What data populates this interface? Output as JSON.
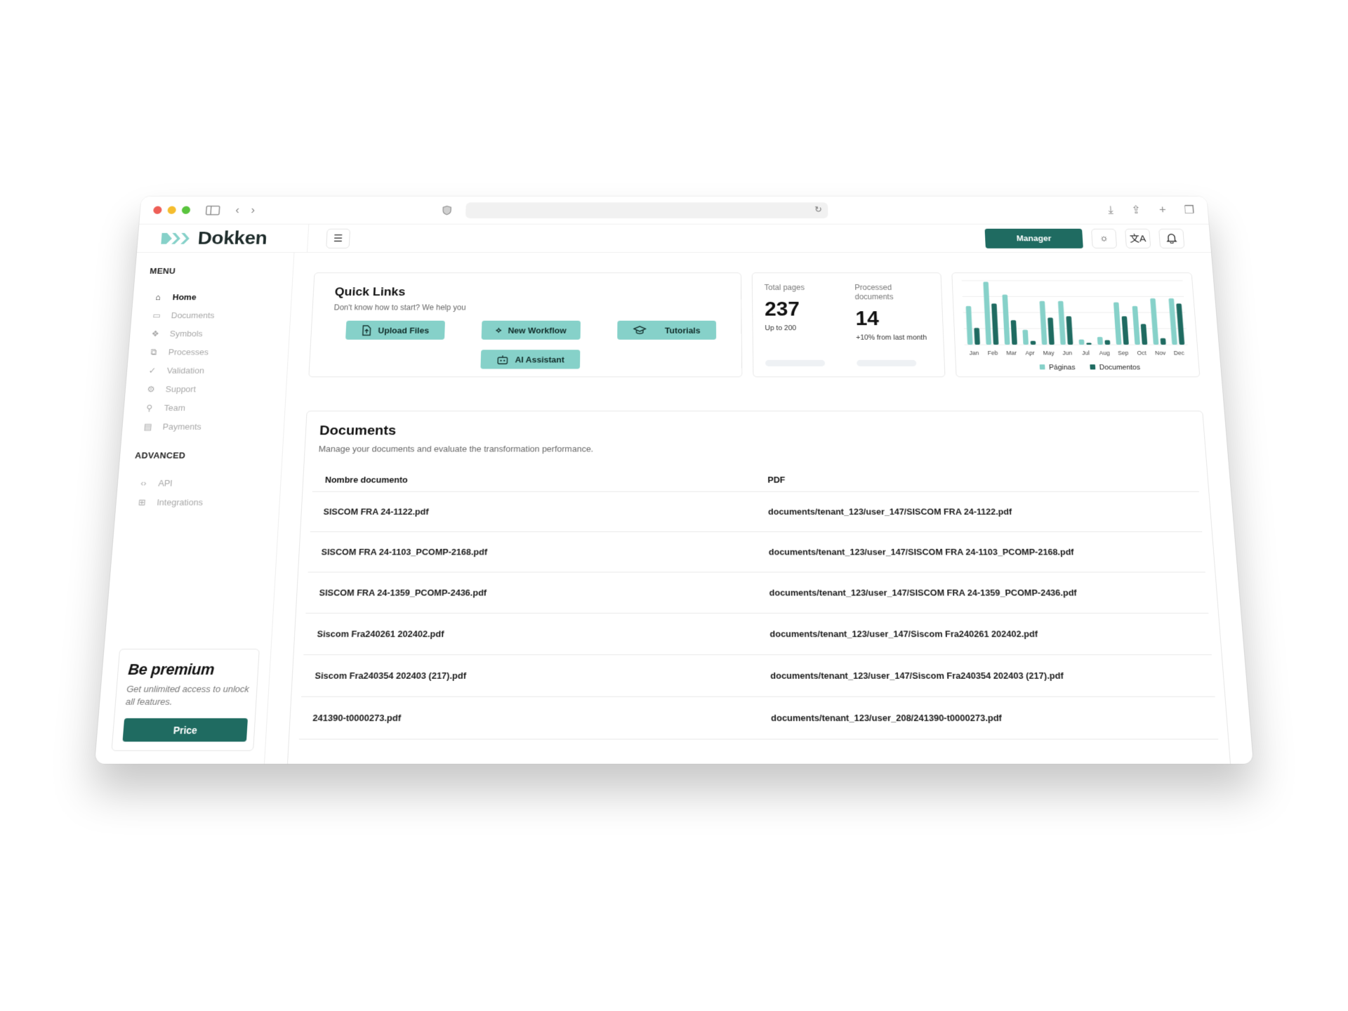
{
  "app": {
    "brand": "Dokken"
  },
  "header": {
    "manager_label": "Manager"
  },
  "sidebar": {
    "menu_label": "MENU",
    "items": [
      {
        "label": "Home",
        "icon": "home-icon",
        "active": true
      },
      {
        "label": "Documents",
        "icon": "folder-icon",
        "active": false
      },
      {
        "label": "Symbols",
        "icon": "symbols-icon",
        "active": false
      },
      {
        "label": "Processes",
        "icon": "processes-icon",
        "active": false
      },
      {
        "label": "Validation",
        "icon": "check-icon",
        "active": false
      },
      {
        "label": "Support",
        "icon": "gear-icon",
        "active": false
      },
      {
        "label": "Team",
        "icon": "user-icon",
        "active": false
      },
      {
        "label": "Payments",
        "icon": "card-icon",
        "active": false
      }
    ],
    "advanced_label": "ADVANCED",
    "advanced_items": [
      {
        "label": "API",
        "icon": "code-icon"
      },
      {
        "label": "Integrations",
        "icon": "integrations-icon"
      }
    ],
    "premium": {
      "title": "Be premium",
      "text": "Get unlimited access to unlock all features.",
      "button": "Price"
    }
  },
  "quick_links": {
    "title": "Quick Links",
    "subtitle": "Don't know how to start? We help you",
    "buttons": [
      {
        "label": "Upload Files",
        "icon": "upload-icon"
      },
      {
        "label": "New Workflow",
        "icon": "workflow-icon"
      },
      {
        "label": "Tutorials",
        "icon": "graduation-cap-icon"
      },
      {
        "label": "AI Assistant",
        "icon": "robot-icon"
      }
    ]
  },
  "stats": {
    "total_pages": {
      "label": "Total pages",
      "value": "237",
      "hint": "Up to 200"
    },
    "processed": {
      "label": "Processed documents",
      "value": "14",
      "hint": "+10% from last month"
    }
  },
  "chart_data": {
    "type": "bar",
    "categories": [
      "Jan",
      "Feb",
      "Mar",
      "Apr",
      "May",
      "Jun",
      "Jul",
      "Aug",
      "Sep",
      "Oct",
      "Nov",
      "Dec"
    ],
    "series": [
      {
        "name": "Páginas",
        "color": "#86d1c9",
        "values": [
          60,
          98,
          78,
          23,
          68,
          68,
          8,
          12,
          66,
          60,
          72,
          72
        ]
      },
      {
        "name": "Documentos",
        "color": "#1f6b61",
        "values": [
          26,
          64,
          38,
          6,
          42,
          44,
          3,
          7,
          44,
          32,
          10,
          64
        ]
      }
    ],
    "ylim": [
      0,
      100
    ],
    "grid": true,
    "legend": "bottom"
  },
  "documents": {
    "title": "Documents",
    "subtitle": "Manage your documents and evaluate the transformation performance.",
    "columns": [
      "Nombre documento",
      "PDF"
    ],
    "rows": [
      [
        "SISCOM FRA 24-1122.pdf",
        "documents/tenant_123/user_147/SISCOM FRA 24-1122.pdf"
      ],
      [
        "SISCOM FRA 24-1103_PCOMP-2168.pdf",
        "documents/tenant_123/user_147/SISCOM FRA 24-1103_PCOMP-2168.pdf"
      ],
      [
        "SISCOM FRA 24-1359_PCOMP-2436.pdf",
        "documents/tenant_123/user_147/SISCOM FRA 24-1359_PCOMP-2436.pdf"
      ],
      [
        "Siscom Fra240261 202402.pdf",
        "documents/tenant_123/user_147/Siscom Fra240261 202402.pdf"
      ],
      [
        "Siscom Fra240354 202403 (217).pdf",
        "documents/tenant_123/user_147/Siscom Fra240354 202403 (217).pdf"
      ],
      [
        "241390-t0000273.pdf",
        "documents/tenant_123/user_208/241390-t0000273.pdf"
      ]
    ]
  }
}
